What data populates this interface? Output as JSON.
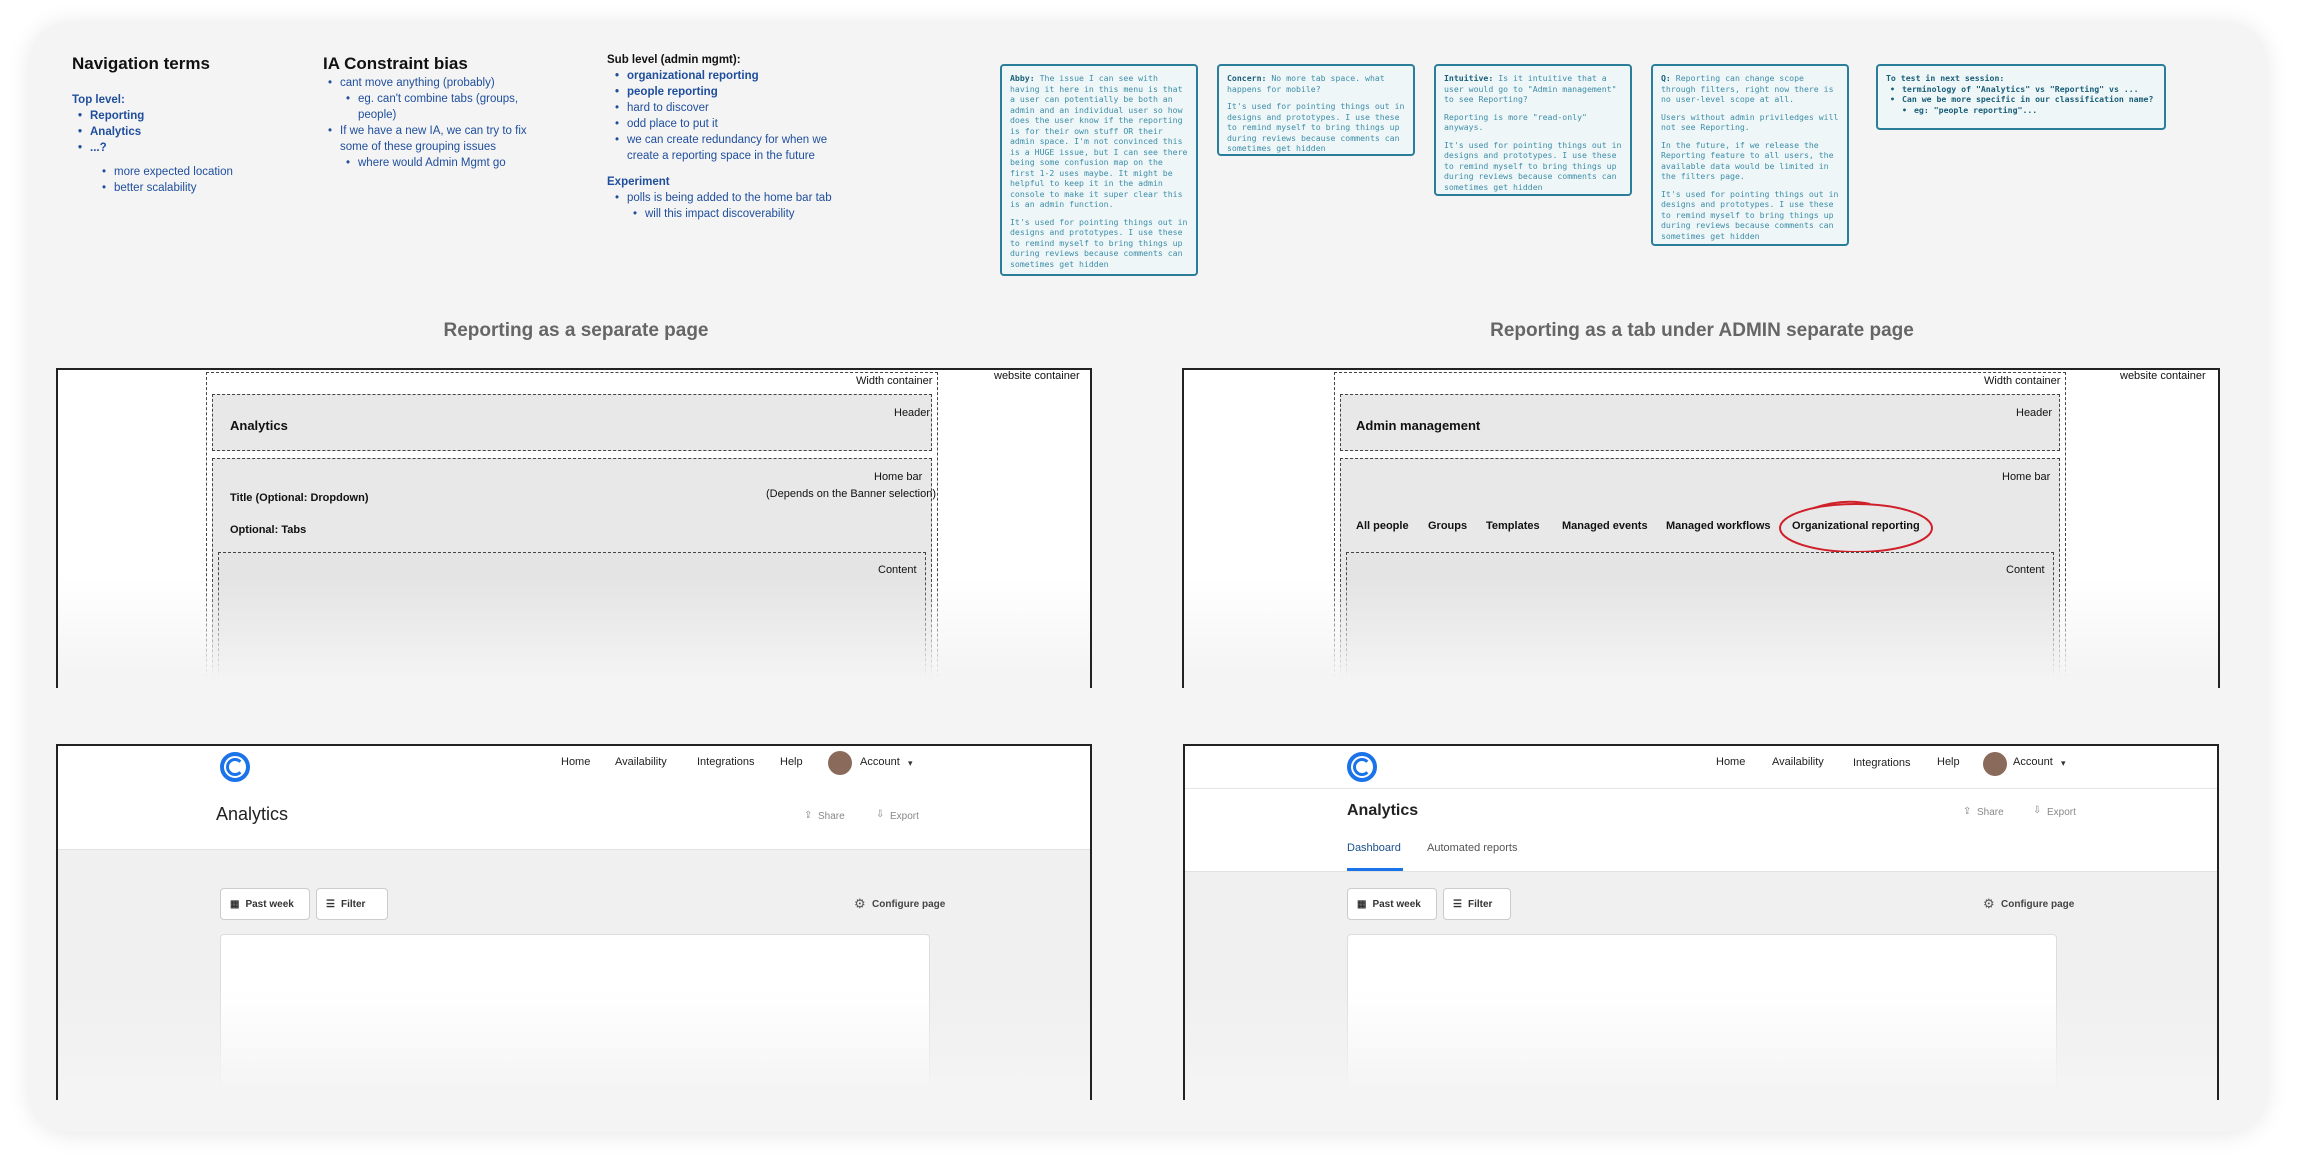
{
  "notes": {
    "nav": {
      "title": "Navigation  terms",
      "top_level": "Top level:",
      "items": [
        "Reporting",
        "Analytics",
        "...?"
      ],
      "sub": [
        "more expected location",
        "better scalability"
      ]
    },
    "ia": {
      "title": "IA Constraint bias",
      "l1": "cant move anything (probably)",
      "l1a": "eg. can't combine tabs (groups, people)",
      "l2": "If we have a new IA, we can try to fix some of these grouping issues",
      "l2a": "where would Admin Mgmt go"
    },
    "sub": {
      "title": "Sub level (admin mgmt):",
      "items": [
        "organizational reporting",
        "people reporting",
        "hard to discover",
        "odd place to put it",
        "we can create redundancy for when we create a reporting space in the future"
      ],
      "exp_title": "Experiment",
      "exp1": "polls is being added to the home bar tab",
      "exp1a": "will this impact discoverability"
    }
  },
  "stickies": {
    "s1": {
      "lead": "Abby:",
      "p1": " The issue I can see with having it here in this menu is that a user can potentially be both an admin and an individual user so how does the user know if the reporting is for their own stuff OR their admin space. I'm not convinced this is a HUGE issue, but I can see there being some confusion map on the first 1-2 uses maybe. It might be helpful to keep it in the admin console to make it super clear this is an admin function.",
      "p2": "It's used for pointing things out in designs and prototypes. I use these to remind myself to bring things up during reviews because comments can sometimes get hidden"
    },
    "s2": {
      "lead": "Concern:",
      "p1": " No more tab space. what happens for mobile?",
      "p2": "It's used for pointing things out in designs and prototypes. I use these to remind myself to bring things up during reviews because comments can sometimes get hidden"
    },
    "s3": {
      "lead": "Intuitive:",
      "p1": " Is it intuitive that a user would go to \"Admin management\" to see Reporting?",
      "p2": "Reporting is more \"read-only\" anyways.",
      "p3": "It's used for pointing things out in designs and prototypes. I use these to remind myself to bring things up during reviews because comments can sometimes get hidden"
    },
    "s4": {
      "lead": "Q:",
      "p1": " Reporting can change scope through filters, right now there is no user-level scope at all.",
      "p2": "Users without admin priviledges will not see Reporting.",
      "p3": "In the future, if we release the Reporting feature to all users, the available data would be limited in the filters page.",
      "p4": "It's used for pointing things out in designs and prototypes. I use these to remind myself to bring things up during reviews because comments can sometimes get hidden"
    },
    "s5": {
      "title": "To test in next session:",
      "i1": "terminology of \"Analytics\" vs \"Reporting\" vs ...",
      "i2": "Can we be more specific in our classification name?",
      "i2a": "eg: \"people reporting\"..."
    }
  },
  "left_title": "Reporting as a separate page",
  "right_title": "Reporting as a tab under ADMIN separate page",
  "wire": {
    "website_container": "website container",
    "width_container": "Width container",
    "header_label": "Header",
    "home_bar": "Home bar",
    "content": "Content",
    "left_header_title": "Analytics",
    "left_title_opt": "Title (Optional: Dropdown)",
    "left_tabs_opt": "Optional: Tabs",
    "left_depends": "(Depends on the Banner selection)",
    "right_header_title": "Admin management",
    "right_tabs": [
      "All people",
      "Groups",
      "Templates",
      "Managed events",
      "Managed workflows",
      "Organizational reporting"
    ]
  },
  "app": {
    "nav": [
      "Home",
      "Availability",
      "Integrations",
      "Help"
    ],
    "account": "Account",
    "title": "Analytics",
    "share": "Share",
    "export": "Export",
    "past_week": "Past week",
    "filter": "Filter",
    "configure": "Configure page",
    "tabs": [
      "Dashboard",
      "Automated reports"
    ],
    "colors": {
      "brand": "#1a73e8",
      "annotation": "#d0202a",
      "sticky_border": "#2b7e99"
    }
  }
}
